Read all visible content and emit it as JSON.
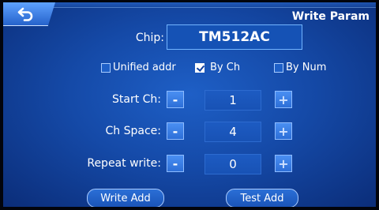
{
  "screen": {
    "title": "Write Param"
  },
  "chip": {
    "label": "Chip:",
    "value": "TM512AC"
  },
  "options": [
    {
      "label": "Unified addr",
      "checked": false
    },
    {
      "label": "By Ch",
      "checked": true
    },
    {
      "label": "By Num",
      "checked": false
    }
  ],
  "fields": [
    {
      "label": "Start Ch:",
      "value": "1",
      "minus": "-",
      "plus": "+"
    },
    {
      "label": "Ch Space:",
      "value": "4",
      "minus": "-",
      "plus": "+"
    },
    {
      "label": "Repeat write:",
      "value": "0",
      "minus": "-",
      "plus": "+"
    }
  ],
  "buttons": {
    "write_add": "Write Add",
    "test_add": "Test Add"
  },
  "icons": {
    "back": "back-arrow-icon"
  },
  "colors": {
    "accent": "#1e5fc6",
    "border": "#72b4ff"
  }
}
